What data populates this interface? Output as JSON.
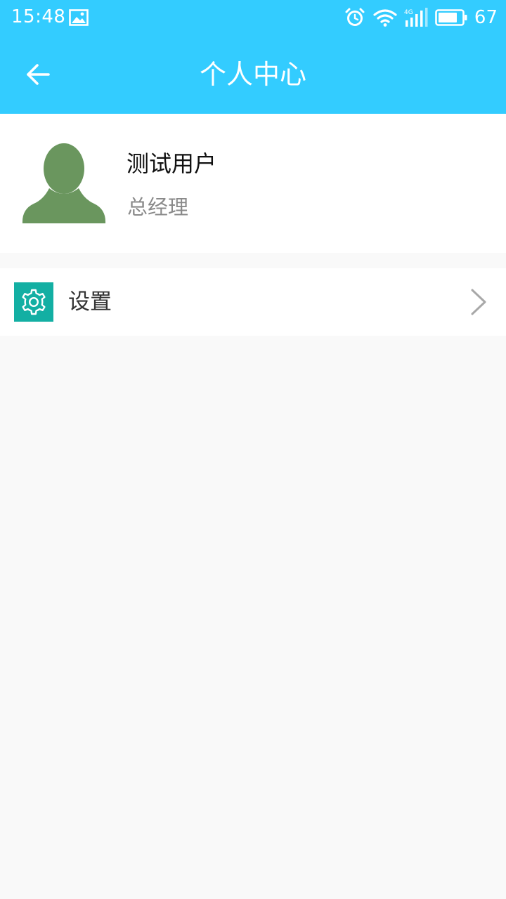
{
  "status_bar": {
    "time": "15:48",
    "battery_level": "67",
    "network_type": "4G",
    "icons": [
      "gallery-icon",
      "alarm-icon",
      "wifi-icon",
      "signal-icon",
      "battery-icon"
    ]
  },
  "app_bar": {
    "title": "个人中心",
    "back_icon": "arrow-left-icon"
  },
  "profile": {
    "name": "测试用户",
    "role": "总经理",
    "avatar_icon": "person-silhouette-icon"
  },
  "menu": {
    "items": [
      {
        "label": "设置",
        "icon": "gear-icon"
      }
    ]
  },
  "colors": {
    "header_bg": "#33ccff",
    "settings_icon_bg": "#13afa3",
    "avatar_color": "#6a965e",
    "page_bg": "#f9f9f9"
  }
}
